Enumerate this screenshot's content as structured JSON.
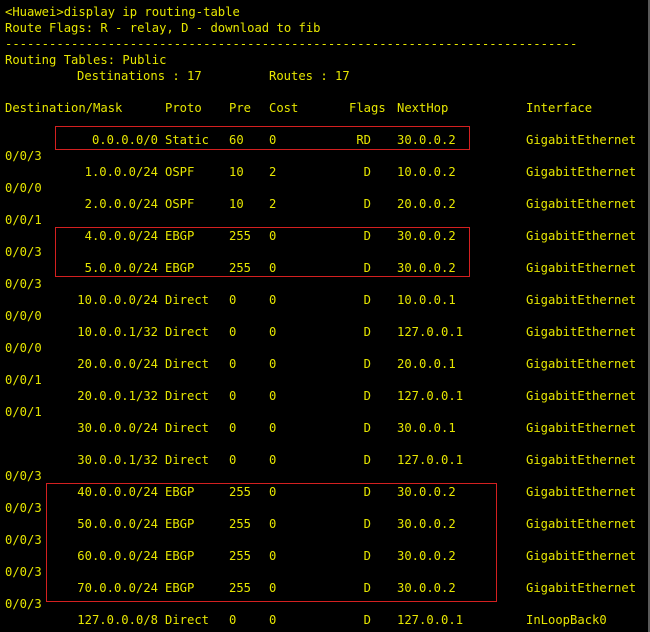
{
  "terminal": {
    "command_line": "<Huawei>display ip routing-table",
    "flags_line": "Route Flags: R - relay, D - download to fib",
    "separator": "------------------------------------------------------------------------------",
    "tables_line": "Routing Tables: Public",
    "summary": {
      "destinations_label": "Destinations : 17",
      "routes_label": "Routes : 17"
    },
    "columns": [
      "Destination/Mask",
      "Proto",
      "Pre",
      "Cost",
      "Flags",
      "NextHop",
      "Interface"
    ],
    "rows": [
      {
        "dest": "0.0.0.0/0",
        "proto": "Static",
        "pre": "60",
        "cost": "0",
        "flags": "RD",
        "nexthop": "30.0.0.2",
        "iface": "GigabitEthernet",
        "iface_cont": "0/0/3"
      },
      {
        "dest": "1.0.0.0/24",
        "proto": "OSPF",
        "pre": "10",
        "cost": "2",
        "flags": "D",
        "nexthop": "10.0.0.2",
        "iface": "GigabitEthernet",
        "iface_cont": "0/0/0"
      },
      {
        "dest": "2.0.0.0/24",
        "proto": "OSPF",
        "pre": "10",
        "cost": "2",
        "flags": "D",
        "nexthop": "20.0.0.2",
        "iface": "GigabitEthernet",
        "iface_cont": "0/0/1"
      },
      {
        "dest": "4.0.0.0/24",
        "proto": "EBGP",
        "pre": "255",
        "cost": "0",
        "flags": "D",
        "nexthop": "30.0.0.2",
        "iface": "GigabitEthernet",
        "iface_cont": "0/0/3"
      },
      {
        "dest": "5.0.0.0/24",
        "proto": "EBGP",
        "pre": "255",
        "cost": "0",
        "flags": "D",
        "nexthop": "30.0.0.2",
        "iface": "GigabitEthernet",
        "iface_cont": "0/0/3"
      },
      {
        "dest": "10.0.0.0/24",
        "proto": "Direct",
        "pre": "0",
        "cost": "0",
        "flags": "D",
        "nexthop": "10.0.0.1",
        "iface": "GigabitEthernet",
        "iface_cont": "0/0/0"
      },
      {
        "dest": "10.0.0.1/32",
        "proto": "Direct",
        "pre": "0",
        "cost": "0",
        "flags": "D",
        "nexthop": "127.0.0.1",
        "iface": "GigabitEthernet",
        "iface_cont": "0/0/0"
      },
      {
        "dest": "20.0.0.0/24",
        "proto": "Direct",
        "pre": "0",
        "cost": "0",
        "flags": "D",
        "nexthop": "20.0.0.1",
        "iface": "GigabitEthernet",
        "iface_cont": "0/0/1"
      },
      {
        "dest": "20.0.0.1/32",
        "proto": "Direct",
        "pre": "0",
        "cost": "0",
        "flags": "D",
        "nexthop": "127.0.0.1",
        "iface": "GigabitEthernet",
        "iface_cont": "0/0/1"
      },
      {
        "dest": "30.0.0.0/24",
        "proto": "Direct",
        "pre": "0",
        "cost": "0",
        "flags": "D",
        "nexthop": "30.0.0.1",
        "iface": "GigabitEthernet",
        "iface_cont": ""
      },
      {
        "dest": "30.0.0.1/32",
        "proto": "Direct",
        "pre": "0",
        "cost": "0",
        "flags": "D",
        "nexthop": "127.0.0.1",
        "iface": "GigabitEthernet",
        "iface_cont": "0/0/3"
      },
      {
        "dest": "40.0.0.0/24",
        "proto": "EBGP",
        "pre": "255",
        "cost": "0",
        "flags": "D",
        "nexthop": "30.0.0.2",
        "iface": "GigabitEthernet",
        "iface_cont": "0/0/3"
      },
      {
        "dest": "50.0.0.0/24",
        "proto": "EBGP",
        "pre": "255",
        "cost": "0",
        "flags": "D",
        "nexthop": "30.0.0.2",
        "iface": "GigabitEthernet",
        "iface_cont": "0/0/3"
      },
      {
        "dest": "60.0.0.0/24",
        "proto": "EBGP",
        "pre": "255",
        "cost": "0",
        "flags": "D",
        "nexthop": "30.0.0.2",
        "iface": "GigabitEthernet",
        "iface_cont": "0/0/3"
      },
      {
        "dest": "70.0.0.0/24",
        "proto": "EBGP",
        "pre": "255",
        "cost": "0",
        "flags": "D",
        "nexthop": "30.0.0.2",
        "iface": "GigabitEthernet",
        "iface_cont": "0/0/3"
      },
      {
        "dest": "127.0.0.0/8",
        "proto": "Direct",
        "pre": "0",
        "cost": "0",
        "flags": "D",
        "nexthop": "127.0.0.1",
        "iface": "InLoopBack0",
        "iface_cont": ""
      }
    ],
    "highlight_color": "#d42020",
    "text_color": "#e6e600",
    "background_color": "#000000"
  }
}
